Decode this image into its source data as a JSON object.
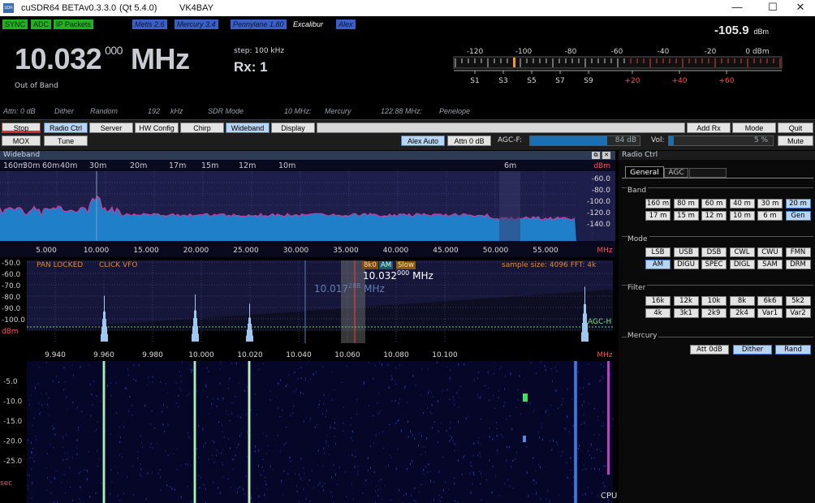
{
  "window": {
    "app_title": "cuSDR64 BETA",
    "version": "v0.3.3.0",
    "qt": "(Qt 5.4.0)",
    "callsign": "VK4BAY",
    "min": "—",
    "max": "☐",
    "close": "✕"
  },
  "status": {
    "sync": "SYNC",
    "adc": "ADC",
    "ip": "IP Packets",
    "metis": "Metis 2.6",
    "mercury": "Mercury 3.4",
    "pennylane": "Pennylane 1.80",
    "excalibur": "Excalibur",
    "alex": "Alex"
  },
  "vfo": {
    "main": "10.032",
    "sub": "000",
    "unit": "MHz",
    "step": "step: 100 kHz",
    "rx": "Rx: 1",
    "band_note": "Out of Band"
  },
  "meter": {
    "value": "-105.9",
    "unit": "dBm",
    "top_labels": [
      "-120",
      "-100",
      "-80",
      "-60",
      "-40",
      "-20",
      "0 dBm"
    ],
    "s_labels": [
      "S1",
      "S3",
      "S5",
      "S7",
      "S9",
      "+20",
      "+40",
      "+60"
    ]
  },
  "info": {
    "attn": "Attn: 0 dB",
    "dither": "Dither",
    "random": "Random",
    "samplerate": "192",
    "khz": "kHz",
    "sdrmode": "SDR Mode",
    "ref10": "10 MHz:",
    "ref10v": "Mercury",
    "ref122": "122.88 MHz:",
    "ref122v": "Penelope"
  },
  "toolbar": {
    "stop": "Stop",
    "radio_ctrl": "Radio Ctrl",
    "server": "Server",
    "hwconfig": "HW Config",
    "chirp": "Chirp",
    "wideband": "Wideband",
    "display": "Display",
    "add_rx": "Add Rx",
    "mode": "Mode",
    "quit": "Quit",
    "mox": "MOX",
    "tune": "Tune",
    "alex_auto": "Alex Auto",
    "attn": "Attn 0 dB",
    "agcf_label": "AGC-F:",
    "agcf_value": "84 dB",
    "vol_label": "Vol:",
    "vol_value": "5 %",
    "mute": "Mute"
  },
  "levels": {
    "agcf": 0.7,
    "vol": 0.05
  },
  "wideband": {
    "title": "Wideband",
    "bands": [
      "160m",
      "30m",
      "60m",
      "40m",
      "30m",
      "20m",
      "17m",
      "15m",
      "12m",
      "10m",
      "6m"
    ],
    "y_ticks": [
      "dBm",
      "-60.0",
      "-80.0",
      "-100.0",
      "-120.0",
      "-140.0"
    ],
    "x_ticks": [
      "5.000",
      "10.000",
      "15.000",
      "20.000",
      "25.000",
      "30.000",
      "35.000",
      "40.000",
      "45.000",
      "50.000",
      "55.000",
      "MHz"
    ]
  },
  "panadapter": {
    "y_ticks": [
      "-50.0",
      "-60.0",
      "-70.0",
      "-80.0",
      "-90.0",
      "-100.0",
      "dBm"
    ],
    "locked": "PAN LOCKED",
    "click": "CLICK VFO",
    "filter": "8k0",
    "mode": "AM",
    "agc": "Slow",
    "freq": "10.032",
    "freq_sub": "000",
    "freq_unit": "MHz",
    "mouse_freq": "10.017",
    "mouse_sub": "288",
    "mouse_unit": "MHz",
    "sample": "sample size: 4096  FFT: 4k",
    "agc_h": "AGC-H",
    "x_ticks": [
      "9.940",
      "9.960",
      "9.980",
      "10.000",
      "10.020",
      "10.040",
      "10.060",
      "10.080",
      "10.100",
      "MHz"
    ]
  },
  "waterfall": {
    "y_ticks": [
      "-5.0",
      "-10.0",
      "-15.0",
      "-20.0",
      "-25.0"
    ],
    "unit": "sec",
    "cpu": "CPU l"
  },
  "radio_ctrl": {
    "title": "Radio Ctrl",
    "tabs": [
      "General",
      "AGC"
    ],
    "band_title": "Band",
    "bands": [
      [
        "160 m",
        "80 m",
        "60 m",
        "40 m",
        "30 m",
        "20 m"
      ],
      [
        "17 m",
        "15 m",
        "12 m",
        "10 m",
        "6 m",
        "Gen"
      ]
    ],
    "mode_title": "Mode",
    "modes": [
      [
        "LSB",
        "USB",
        "DSB",
        "CWL",
        "CWU",
        "FMN"
      ],
      [
        "AM",
        "DIGU",
        "SPEC",
        "DIGL",
        "SAM",
        "DRM"
      ]
    ],
    "filter_title": "Filter",
    "filters": [
      [
        "16k",
        "12k",
        "10k",
        "8k",
        "6k6",
        "5k2"
      ],
      [
        "4k",
        "3k1",
        "2k9",
        "2k4",
        "Var1",
        "Var2"
      ]
    ],
    "mercury_title": "Mercury",
    "mercury_buttons": [
      "Att 0dB",
      "Dither",
      "Rand"
    ]
  },
  "colors": {
    "accent": "#ff3b3b",
    "spectrum": "#2d8fd0",
    "trace": "#d33a9a"
  }
}
